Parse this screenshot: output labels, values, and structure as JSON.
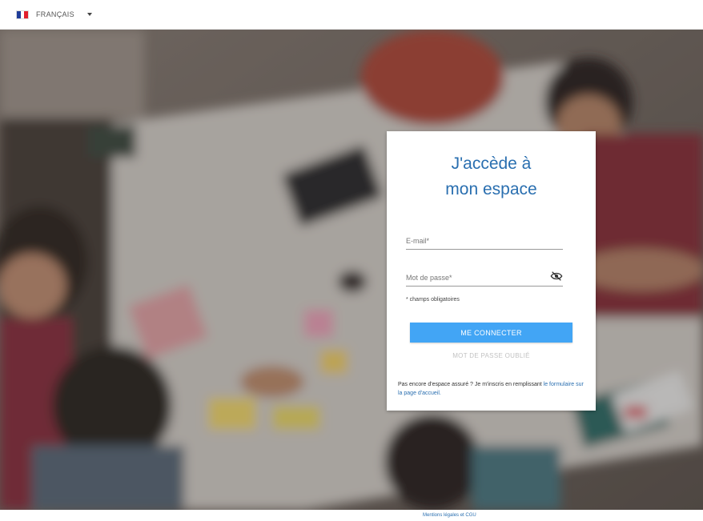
{
  "language": {
    "label": "FRANÇAIS",
    "flag_colors": [
      "#1f3d99",
      "#ffffff",
      "#e21f2b"
    ]
  },
  "login": {
    "title_line1": "J'accède à",
    "title_line2": "mon espace",
    "email_placeholder": "E-mail*",
    "email_value": "",
    "password_placeholder": "Mot de passe*",
    "password_value": "",
    "required_note": "* champs obligatoires",
    "submit_label": "ME CONNECTER",
    "forgot_label": "MOT DE PASSE OUBLIÉ",
    "help_text": "Pas encore d'espace assuré ? Je m'inscris en remplissant ",
    "help_link": "le formulaire sur la page d'accueil."
  },
  "footer": {
    "legal_link": "Mentions légales et CGU"
  },
  "colors": {
    "title_blue": "#2a6fb0",
    "button_blue": "#42a5f5"
  },
  "icons": {
    "language_caret": "chevron-down-icon",
    "password_toggle": "eye-off-icon",
    "flag": "france-flag-icon"
  }
}
